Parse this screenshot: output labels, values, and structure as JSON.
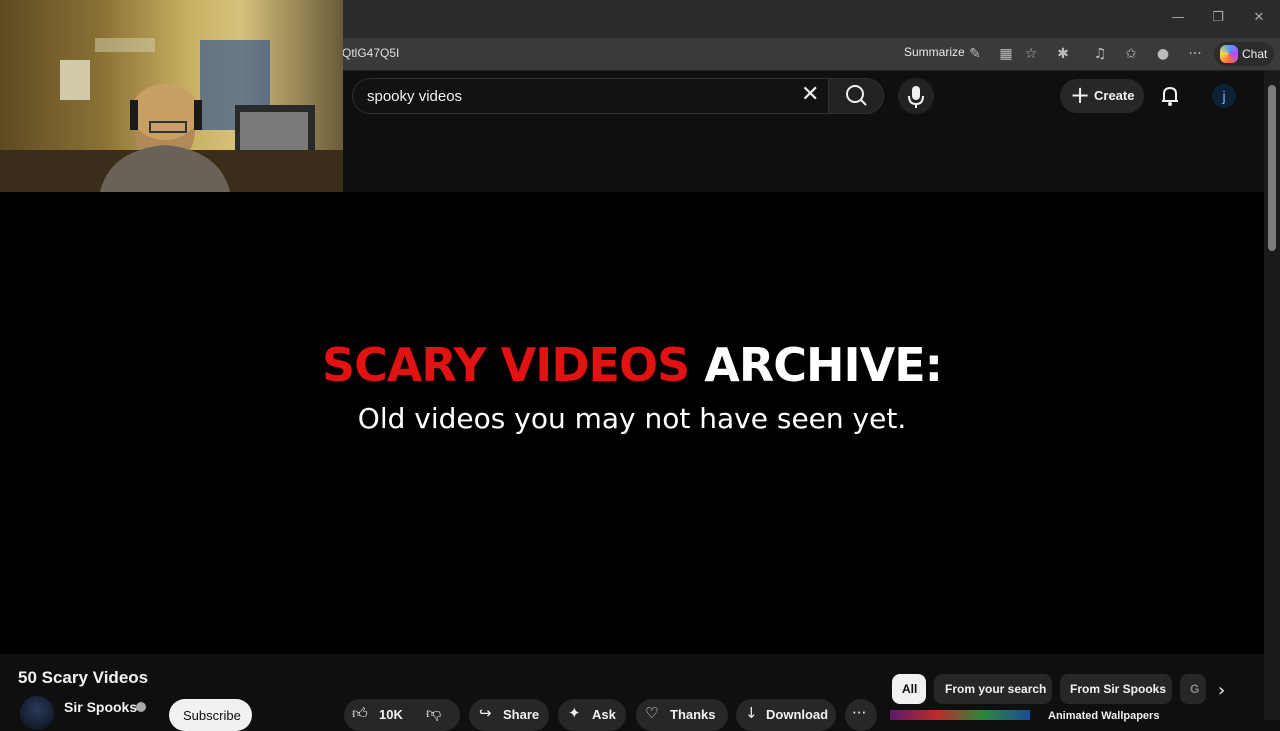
{
  "browser": {
    "url_fragment": "QtlG47Q5I",
    "summarize_label": "Summarize",
    "chat_label": "Chat",
    "window_controls": [
      "minimize-icon",
      "restore-icon",
      "close-icon"
    ]
  },
  "header": {
    "search_value": "spooky videos",
    "create_label": "Create",
    "avatar_initial": "j"
  },
  "player": {
    "title_red": "SCARY VIDEOS",
    "title_white": "ARCHIVE:",
    "subtitle": "Old videos you may not have seen yet."
  },
  "video": {
    "title": "50 Scary Videos",
    "channel": "Sir Spooks",
    "subscribe_label": "Subscribe",
    "likes": "10K",
    "share_label": "Share",
    "ask_label": "Ask",
    "thanks_label": "Thanks",
    "download_label": "Download"
  },
  "chips": [
    "All",
    "From your search",
    "From Sir Spooks",
    "G"
  ],
  "recommendation": {
    "title": "Animated Wallpapers"
  }
}
